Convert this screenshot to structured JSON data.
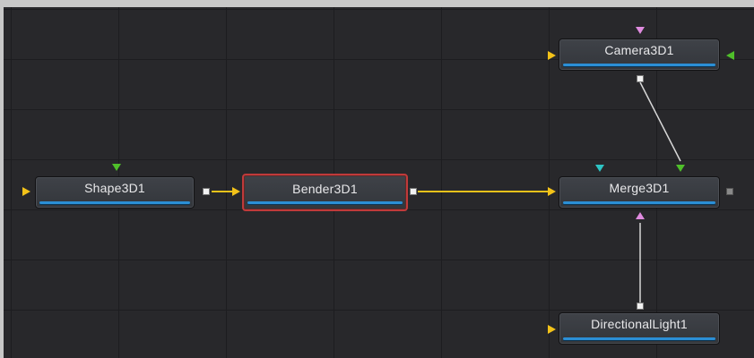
{
  "colors": {
    "canvas_bg": "#28282b",
    "node_bg": "#3a3d42",
    "node_text": "#e8e8ea",
    "node_bar": "#2b8fd6",
    "selected_border": "#c03a3a",
    "background_input": "#f3c219",
    "scene_input": "#4fbf2a",
    "camera_input": "#e08be0",
    "merge_input": "#2ec4c4",
    "light_input": "#e08be0",
    "wire_main": "#e8c21a",
    "wire_secondary": "#d8d8d8"
  },
  "nodes": {
    "shape": {
      "label": "Shape3D1",
      "selected": false
    },
    "bender": {
      "label": "Bender3D1",
      "selected": true
    },
    "merge": {
      "label": "Merge3D1",
      "selected": false
    },
    "camera": {
      "label": "Camera3D1",
      "selected": false
    },
    "light": {
      "label": "DirectionalLight1",
      "selected": false
    }
  },
  "connections": [
    {
      "from": "Shape3D1",
      "to": "Bender3D1",
      "style": "main"
    },
    {
      "from": "Bender3D1",
      "to": "Merge3D1",
      "style": "main"
    },
    {
      "from": "Camera3D1",
      "to": "Merge3D1",
      "style": "secondary"
    },
    {
      "from": "DirectionalLight1",
      "to": "Merge3D1",
      "style": "secondary"
    }
  ],
  "icons": {
    "input_arrow": "triangle-right",
    "output_port": "square",
    "top_input": "triangle-down",
    "bottom_input": "triangle-up"
  }
}
